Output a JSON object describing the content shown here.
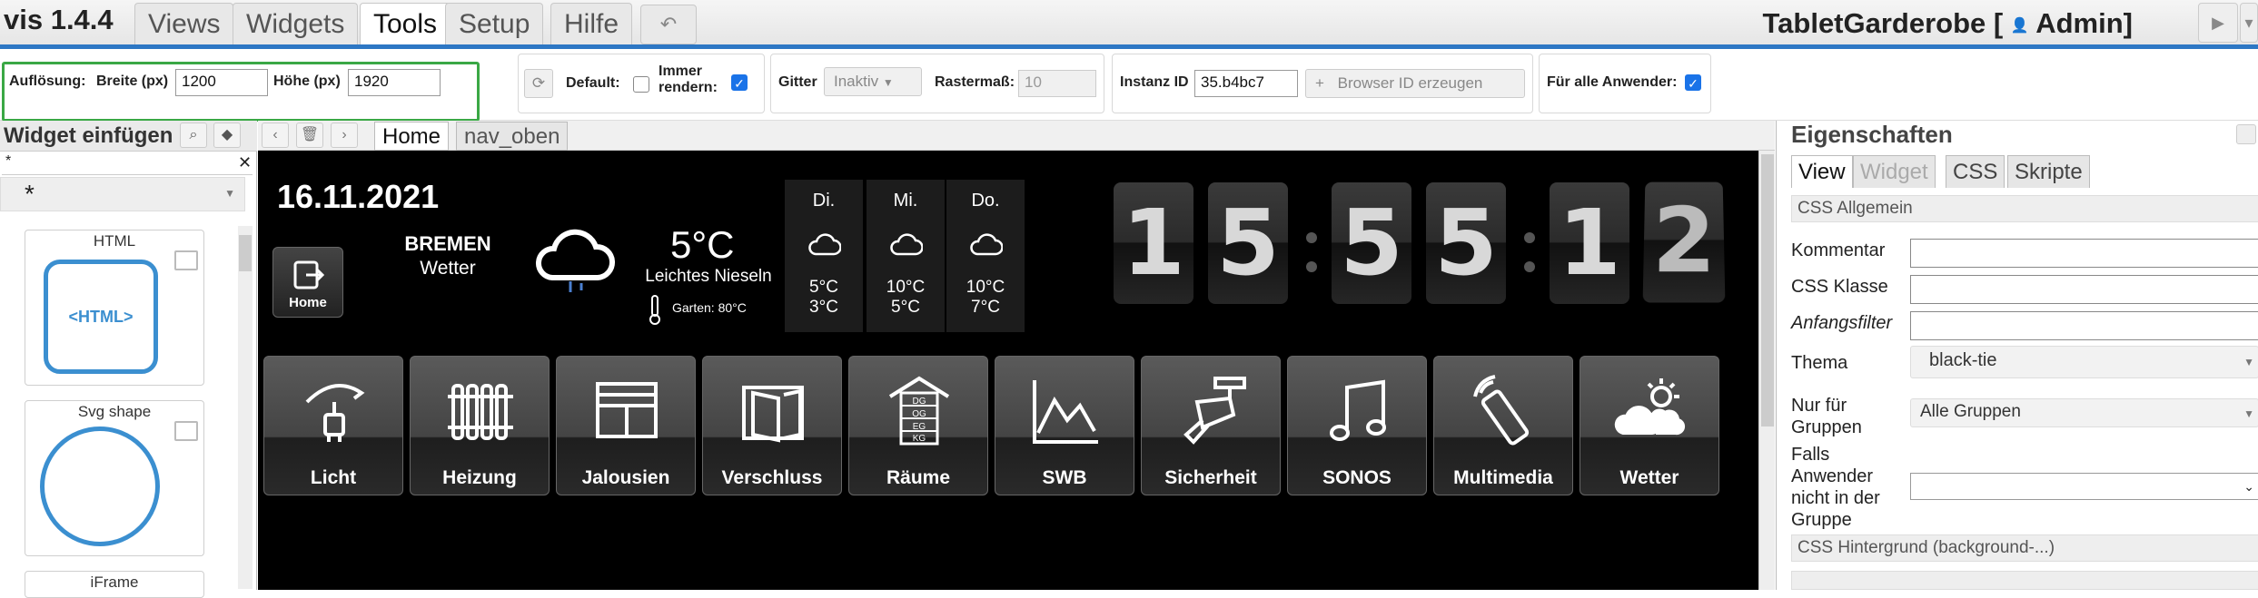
{
  "app": {
    "brand": "vis 1.4.4",
    "project_title": "TabletGarderobe [",
    "user": "Admin]"
  },
  "menu": {
    "tabs": [
      "Views",
      "Widgets",
      "Tools",
      "Setup",
      "Hilfe"
    ],
    "active": "Tools"
  },
  "toolbar": {
    "resolution_label": "Auflösung:",
    "width_label": "Breite (px)",
    "width_value": "1200",
    "height_label": "Höhe (px)",
    "height_value": "1920",
    "default_label": "Default:",
    "always_render_label": "Immer rendern:",
    "grid_label": "Gitter",
    "grid_value": "Inaktiv",
    "raster_label": "Rastermaß:",
    "raster_value": "10",
    "instance_label": "Instanz ID",
    "instance_value": "35.b4bc7",
    "browser_id_button": "Browser ID erzeugen",
    "all_users_label": "Für alle Anwender:"
  },
  "left_panel": {
    "title": "Widget einfügen",
    "filter_value": "*",
    "category": "*",
    "widgets": [
      {
        "name": "HTML",
        "preview": "<HTML>"
      },
      {
        "name": "Svg shape"
      },
      {
        "name": "iFrame"
      }
    ]
  },
  "view_tabs": {
    "tabs": [
      "Home",
      "nav_oben"
    ],
    "active": "Home"
  },
  "dashboard": {
    "date": "16.11.2021",
    "home_label": "Home",
    "city": "BREMEN",
    "weather_label": "Wetter",
    "temperature": "5°C",
    "condition": "Leichtes Nieseln",
    "garden": "Garten: 80°C",
    "forecast": [
      {
        "day": "Di.",
        "high": "5°C",
        "low": "3°C"
      },
      {
        "day": "Mi.",
        "high": "10°C",
        "low": "5°C"
      },
      {
        "day": "Do.",
        "high": "10°C",
        "low": "7°C"
      }
    ],
    "clock_digits": [
      "1",
      "5",
      "5",
      "5",
      "1",
      "2"
    ],
    "tiles": [
      "Licht",
      "Heizung",
      "Jalousien",
      "Verschluss",
      "Räume",
      "SWB",
      "Sicherheit",
      "SONOS",
      "Multimedia",
      "Wetter"
    ],
    "floor_labels": [
      "DG",
      "OG",
      "EG",
      "KG"
    ]
  },
  "right_panel": {
    "title": "Eigenschaften",
    "tabs": [
      "View",
      "Widget",
      "CSS",
      "Skripte"
    ],
    "active_tab": "View",
    "section_general": "CSS Allgemein",
    "comment_label": "Kommentar",
    "css_class_label": "CSS Klasse",
    "filter_label": "Anfangsfilter",
    "theme_label": "Thema",
    "theme_value": "black-tie",
    "groups_label": "Nur für Gruppen",
    "groups_value": "Alle Gruppen",
    "notin_label": "Falls Anwender nicht in der Gruppe",
    "section_bg": "CSS Hintergrund (background-...)"
  }
}
